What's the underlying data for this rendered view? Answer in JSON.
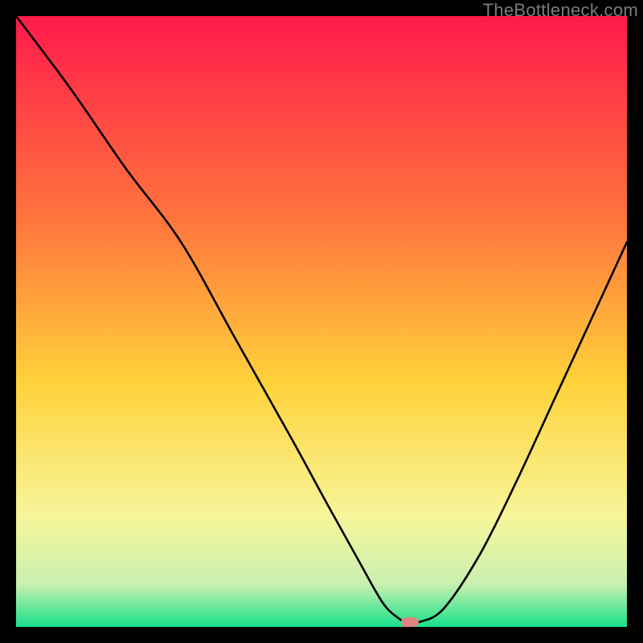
{
  "watermark": "TheBottleneck.com",
  "colors": {
    "top": "#ff1a4b",
    "mid_upper": "#ff7a3c",
    "mid": "#ffd23a",
    "mid_lower": "#f7f59a",
    "bottom_upper": "#c9f0b0",
    "bottom": "#17e08a",
    "curve": "#000000",
    "marker": "#de847f",
    "frame": "#000000"
  },
  "chart_data": {
    "type": "line",
    "title": "",
    "xlabel": "",
    "ylabel": "",
    "xlim": [
      0,
      100
    ],
    "ylim": [
      0,
      100
    ],
    "grid": false,
    "series": [
      {
        "name": "bottleneck-curve",
        "x": [
          0,
          9,
          18,
          27,
          36,
          45,
          51,
          56,
          60,
          62.5,
          64,
          66,
          70,
          76,
          82,
          88,
          94,
          100
        ],
        "y": [
          100,
          88,
          75,
          63,
          47,
          31,
          20,
          11,
          4,
          1.5,
          0.8,
          0.8,
          3,
          12,
          24,
          37,
          50,
          63
        ]
      }
    ],
    "marker": {
      "x": 64.5,
      "y": 0.8,
      "color": "#de847f"
    }
  }
}
